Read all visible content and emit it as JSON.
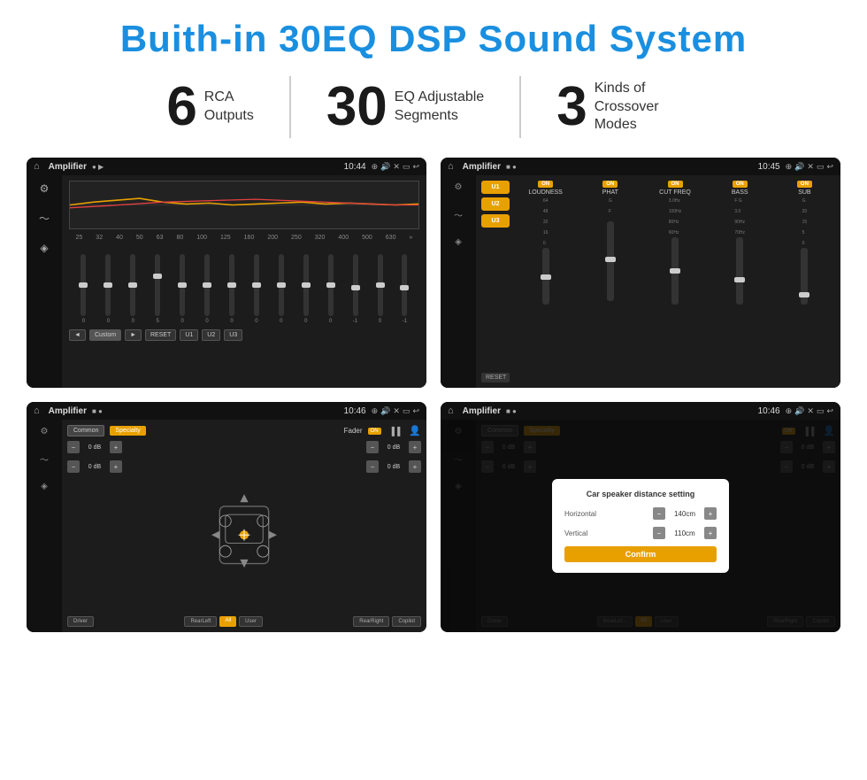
{
  "page": {
    "title": "Buith-in 30EQ DSP Sound System",
    "stats": [
      {
        "number": "6",
        "label": "RCA\nOutputs"
      },
      {
        "number": "30",
        "label": "EQ Adjustable\nSegments"
      },
      {
        "number": "3",
        "label": "Kinds of\nCrossover Modes"
      }
    ]
  },
  "screens": {
    "eq": {
      "title": "Amplifier",
      "time": "10:44",
      "frequencies": [
        "25",
        "32",
        "40",
        "50",
        "63",
        "80",
        "100",
        "125",
        "160",
        "200",
        "250",
        "320",
        "400",
        "500",
        "630"
      ],
      "values": [
        "0",
        "0",
        "0",
        "5",
        "0",
        "0",
        "0",
        "0",
        "0",
        "0",
        "0",
        "-1",
        "0",
        "-1"
      ],
      "buttons": [
        "◄",
        "Custom",
        "►",
        "RESET",
        "U1",
        "U2",
        "U3"
      ]
    },
    "dsp": {
      "title": "Amplifier",
      "time": "10:45",
      "presets": [
        "U1",
        "U2",
        "U3"
      ],
      "channels": [
        "LOUDNESS",
        "PHAT",
        "CUT FREQ",
        "BASS",
        "SUB"
      ],
      "resetLabel": "RESET"
    },
    "fader": {
      "title": "Amplifier",
      "time": "10:46",
      "commonLabel": "Common",
      "specialtyLabel": "Specialty",
      "faderLabel": "Fader",
      "onLabel": "ON",
      "dbValues": [
        "0 dB",
        "0 dB",
        "0 dB",
        "0 dB"
      ],
      "bottomBtns": [
        "Driver",
        "RearLeft",
        "All",
        "User",
        "RearRight",
        "Copilot"
      ]
    },
    "dialog": {
      "title": "Amplifier",
      "time": "10:46",
      "commonLabel": "Common",
      "specialtyLabel": "Specialty",
      "onLabel": "ON",
      "dialogTitle": "Car speaker distance setting",
      "horizontalLabel": "Horizontal",
      "horizontalValue": "140cm",
      "verticalLabel": "Vertical",
      "verticalValue": "110cm",
      "dbValues": [
        "0 dB",
        "0 dB"
      ],
      "confirmLabel": "Confirm",
      "bottomBtns": [
        "Driver",
        "RearLef...",
        "All",
        "User",
        "RearRight",
        "Copilot"
      ]
    }
  }
}
